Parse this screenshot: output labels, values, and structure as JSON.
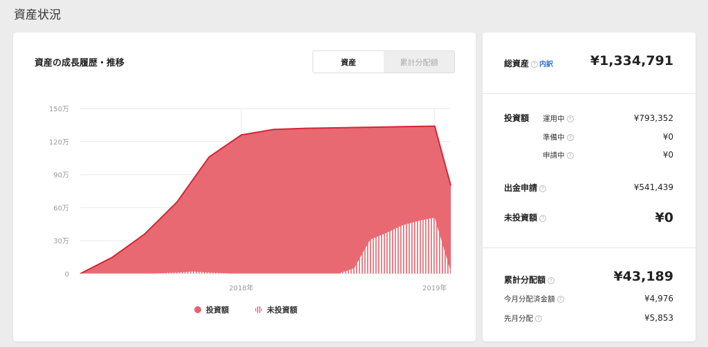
{
  "page": {
    "title": "資産状況"
  },
  "chart_card": {
    "title": "資産の成長履歴・推移",
    "tabs": [
      {
        "label": "資産",
        "active": true
      },
      {
        "label": "累計分配額",
        "active": false
      }
    ]
  },
  "legend": [
    {
      "label": "投資額",
      "style": "solid"
    },
    {
      "label": "未投資額",
      "style": "hatched"
    }
  ],
  "colors": {
    "accent": "#e8616c",
    "line": "#d42533",
    "grid": "#e9e9e9"
  },
  "chart_data": {
    "type": "area",
    "y_ticks": [
      "150万",
      "120万",
      "90万",
      "60万",
      "30万",
      "0"
    ],
    "ylim": [
      0,
      150
    ],
    "y_unit": "万",
    "x_tick_labels": [
      {
        "label": "2018年",
        "x": 10
      },
      {
        "label": "2019年",
        "x": 22
      }
    ],
    "xlim": [
      0,
      23
    ],
    "grid": true,
    "series": [
      {
        "name": "投資額",
        "style": "solid",
        "x": [
          0,
          2,
          4,
          6,
          8,
          10,
          12,
          14,
          16,
          18,
          20,
          22,
          23
        ],
        "values": [
          0,
          15,
          36,
          65,
          106,
          126,
          131,
          132,
          132.5,
          133,
          133.5,
          134,
          80
        ]
      },
      {
        "name": "未投資額",
        "style": "hatched",
        "x": [
          0,
          2,
          4,
          6,
          7,
          8,
          10,
          12,
          14,
          16,
          17,
          18,
          19,
          20,
          21,
          22,
          23
        ],
        "values": [
          0,
          0,
          0,
          1,
          2,
          1,
          0,
          0,
          0,
          0,
          5,
          31,
          37,
          44,
          48,
          51,
          2
        ]
      }
    ]
  },
  "summary": {
    "total": {
      "label": "総資産",
      "link": "内訳",
      "value": "¥1,334,791"
    },
    "invest": {
      "label": "投資額",
      "items": [
        {
          "label": "運用中",
          "value": "¥793,352"
        },
        {
          "label": "準備中",
          "value": "¥0"
        },
        {
          "label": "申請中",
          "value": "¥0"
        }
      ]
    },
    "withdraw": {
      "label": "出金申請",
      "value": "¥541,439"
    },
    "uninvested": {
      "label": "未投資額",
      "value": "¥0"
    },
    "dividends": {
      "label": "累計分配額",
      "value": "¥43,189",
      "items": [
        {
          "label": "今月分配済金額",
          "value": "¥4,976"
        },
        {
          "label": "先月分配",
          "value": "¥5,853"
        }
      ]
    },
    "help_icon_glyph": "?"
  }
}
